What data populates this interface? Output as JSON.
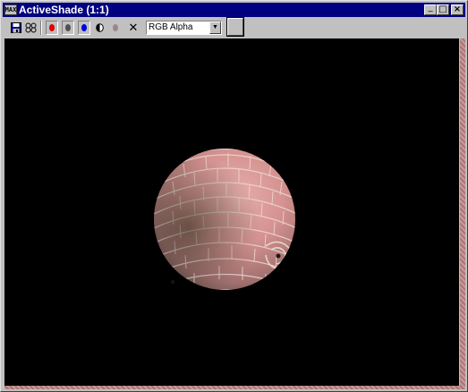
{
  "window": {
    "title": "ActiveShade (1:1)",
    "app_icon_text": "MAX"
  },
  "title_buttons": {
    "minimize": "_",
    "maximize": "□",
    "close": "×"
  },
  "toolbar": {
    "tools": [
      {
        "name": "save-image-icon"
      },
      {
        "name": "clone-image-icon"
      },
      {
        "name": "red-channel-icon",
        "color": "#e00000"
      },
      {
        "name": "green-channel-icon",
        "color": "#505050"
      },
      {
        "name": "blue-channel-icon",
        "color": "#0000e0"
      },
      {
        "name": "alpha-channel-icon",
        "color": "#000000"
      },
      {
        "name": "monochrome-icon",
        "color": "#9a8888"
      },
      {
        "name": "clear-icon"
      }
    ],
    "channel_display": "RGB Alpha",
    "clear_glyph": "✕"
  },
  "viewport": {
    "background": "#000000",
    "subject": "sphere-render"
  },
  "colors": {
    "titlebar": "#000080",
    "chrome": "#c0c0c0",
    "sphere": "#d89898"
  }
}
